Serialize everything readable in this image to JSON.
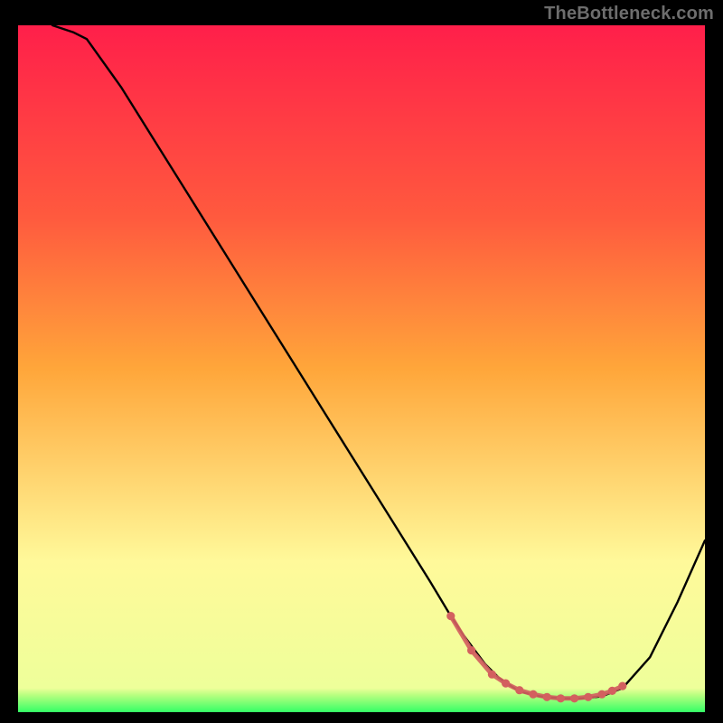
{
  "watermark": "TheBottleneck.com",
  "colors": {
    "gradient_top": "#ff1f4a",
    "gradient_mid": "#ffa63a",
    "gradient_low": "#fff99a",
    "gradient_bottom": "#33ff66",
    "curve": "#000000",
    "marker": "#d3605f",
    "frame": "#000000"
  },
  "chart_data": {
    "type": "line",
    "title": "",
    "xlabel": "",
    "ylabel": "",
    "xlim": [
      0,
      100
    ],
    "ylim": [
      0,
      100
    ],
    "series": [
      {
        "name": "bottleneck-curve",
        "x": [
          5,
          8,
          10,
          15,
          20,
          25,
          30,
          35,
          40,
          45,
          50,
          55,
          60,
          63,
          65,
          68,
          70,
          73,
          76,
          79,
          82,
          85,
          88,
          92,
          96,
          100
        ],
        "y": [
          100,
          99,
          98,
          91,
          83,
          75,
          67,
          59,
          51,
          43,
          35,
          27,
          19,
          14,
          11,
          7,
          5,
          3,
          2.3,
          2,
          2,
          2.3,
          3.5,
          8,
          16,
          25
        ]
      }
    ],
    "markers": {
      "name": "highlighted-range",
      "x": [
        63,
        66,
        69,
        71,
        73,
        75,
        77,
        79,
        81,
        83,
        85,
        86.5,
        88
      ],
      "y": [
        14,
        9,
        5.5,
        4.2,
        3.2,
        2.6,
        2.2,
        2,
        2,
        2.2,
        2.6,
        3.1,
        3.8
      ]
    }
  }
}
